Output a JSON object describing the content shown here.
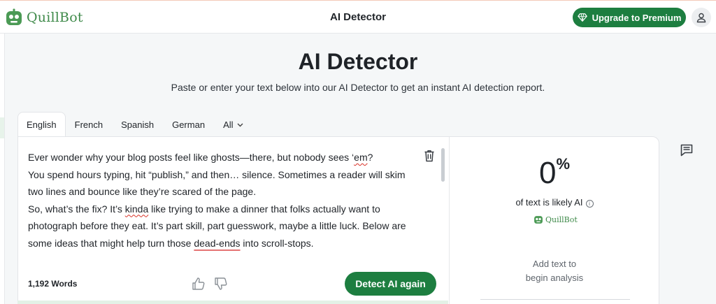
{
  "header": {
    "logo_text": "QuillBot",
    "title": "AI Detector",
    "upgrade_label": "Upgrade to Premium",
    "upgrade_icon": "diamond-icon",
    "account_icon": "user-icon"
  },
  "hero": {
    "title": "AI Detector",
    "subtitle": "Paste or enter your text below into our AI Detector to get an instant AI detection report."
  },
  "tabs": [
    {
      "label": "English",
      "active": true
    },
    {
      "label": "French",
      "active": false
    },
    {
      "label": "Spanish",
      "active": false
    },
    {
      "label": "German",
      "active": false
    },
    {
      "label": "All",
      "active": false
    }
  ],
  "editor": {
    "lines": {
      "l1_a": "Ever wonder why your blog posts feel like ghosts—there, but nobody sees ‘",
      "l1_b": "em",
      "l1_c": "?",
      "l2": "You spend hours typing, hit “publish,” and then… silence. Sometimes a reader will skim",
      "l3": "two lines and bounce like they’re scared of the page.",
      "l4_a": "So, what’s the fix? It’s ",
      "l4_b": "kinda",
      "l4_c": " like trying to make a dinner that folks actually want to",
      "l5": "photograph before they eat. It’s part skill, part guesswork, maybe a little luck. Below are",
      "l6_a": "some ideas that might help turn those ",
      "l6_b": "dead-ends",
      "l6_c": " into scroll-stops."
    },
    "word_count": "1,192 Words",
    "detect_label": "Detect AI again",
    "trash_icon": "trash-icon",
    "thumbs_up_icon": "thumbs-up-icon",
    "thumbs_down_icon": "thumbs-down-icon"
  },
  "results": {
    "percent": "0",
    "percent_sign": "%",
    "likely_label": "of text is likely AI",
    "info_glyph": "i",
    "logo_text": "QuillBot",
    "hint_line1": "Add text to",
    "hint_line2": "begin analysis"
  },
  "side": {
    "comment_icon": "comment-icon"
  },
  "colors": {
    "brand_green": "#1d7e40",
    "logo_green": "#3f8a4a"
  }
}
